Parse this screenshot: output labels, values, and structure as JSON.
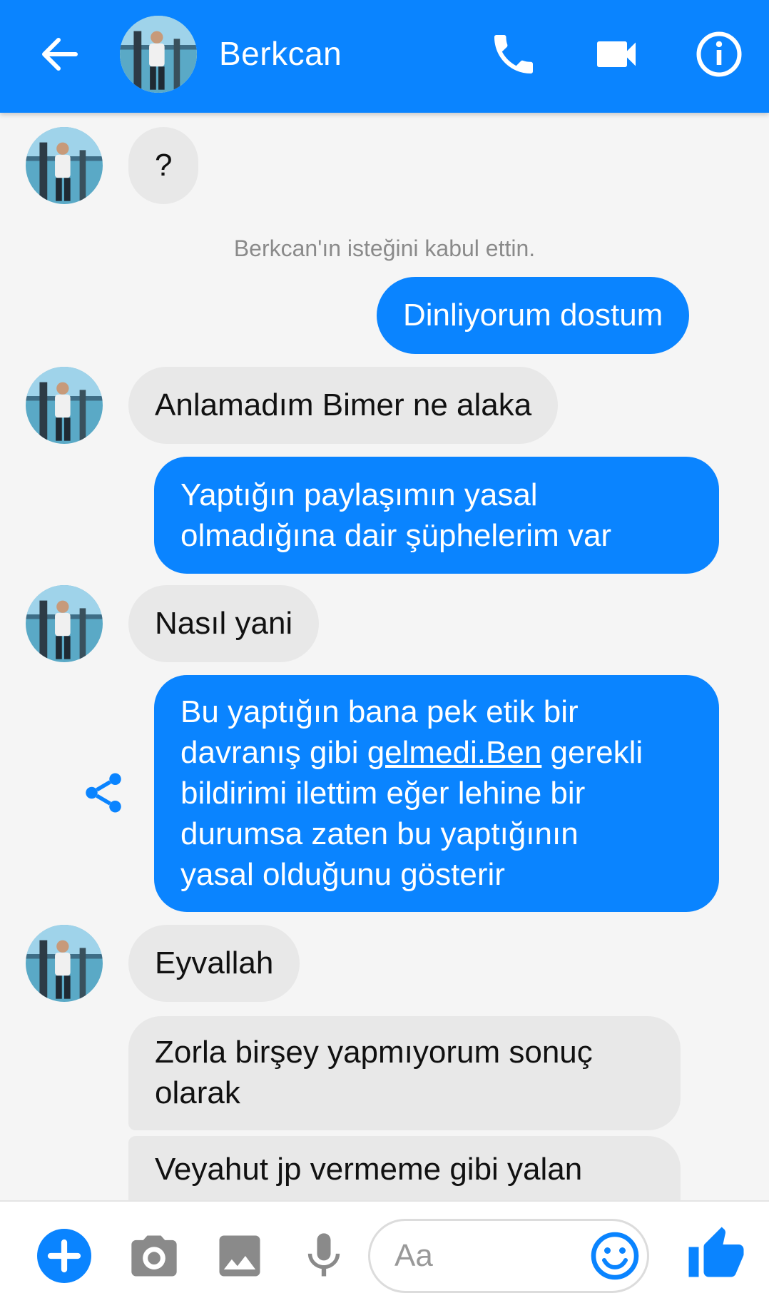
{
  "header": {
    "contact_name": "Berkcan",
    "accent_color": "#0a84ff",
    "icons": [
      "back-arrow-icon",
      "phone-icon",
      "video-camera-icon",
      "info-icon"
    ]
  },
  "messages": [
    {
      "from": "them",
      "text": "?"
    },
    {
      "type": "notice",
      "text": "Berkcan'ın isteğini kabul ettin."
    },
    {
      "from": "me",
      "text": "Dinliyorum dostum"
    },
    {
      "from": "them",
      "text": "Anlamadım Bimer ne alaka"
    },
    {
      "from": "me",
      "text": "Yaptığın paylaşımın yasal\nolmadığına dair şüphelerim var"
    },
    {
      "from": "them",
      "text": "Nasıl yani"
    },
    {
      "from": "me",
      "text_before_link": "Bu yaptığın bana pek etik bir\ndavranış gibi ",
      "link": "gelmedi.Ben",
      "text_after_link": " gerekli\nbildirimi ilettim eğer lehine bir\ndurumsa zaten bu yaptığının\nyasal olduğunu gösterir"
    },
    {
      "from": "them",
      "text": "Eyvallah"
    },
    {
      "from": "them",
      "text": "Zorla birşey yapmıyorum sonuç\nolarak"
    },
    {
      "from": "them",
      "text": "Veyahut jp vermeme gibi yalan"
    }
  ],
  "composer": {
    "placeholder": "Aa",
    "icons": [
      "plus-icon",
      "camera-icon",
      "image-icon",
      "microphone-icon",
      "emoji-icon",
      "thumbs-up-icon"
    ]
  }
}
